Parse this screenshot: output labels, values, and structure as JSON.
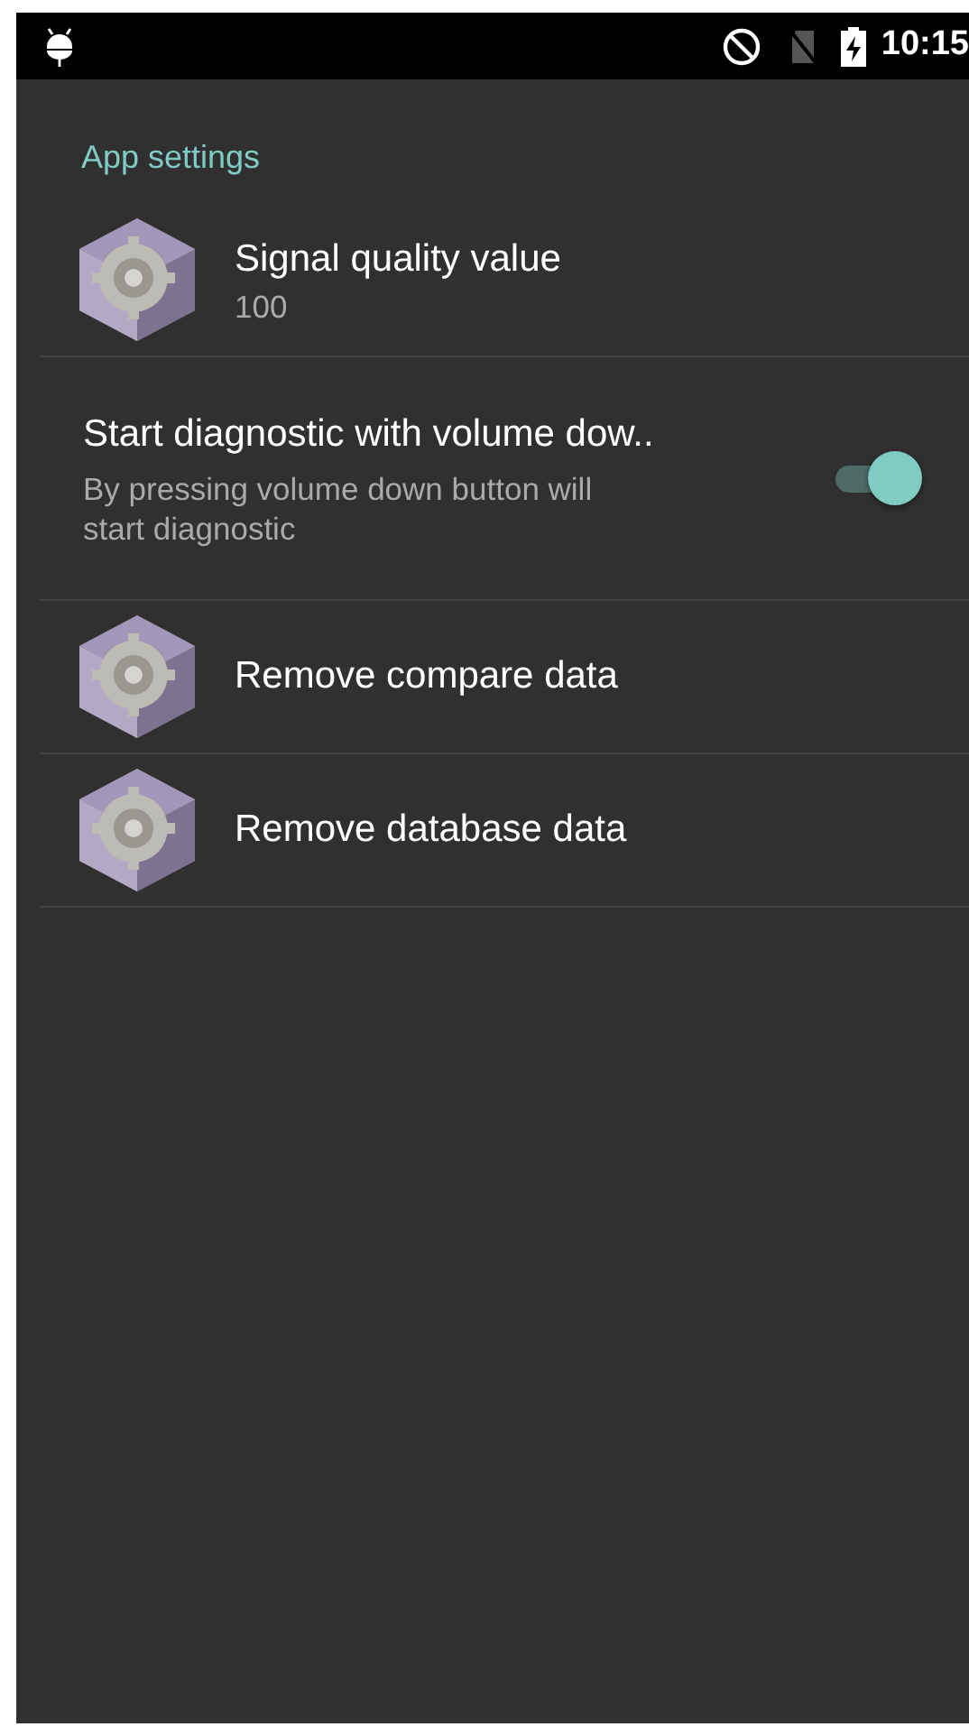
{
  "status_bar": {
    "time": "10:15"
  },
  "section": {
    "title": "App settings"
  },
  "items": [
    {
      "kind": "icon",
      "title": "Signal quality value",
      "summary": "100"
    },
    {
      "kind": "switch",
      "title": "Start diagnostic with volume dow..",
      "summary": "By pressing volume down button will start diagnostic",
      "checked": true
    },
    {
      "kind": "icon",
      "title": "Remove compare data"
    },
    {
      "kind": "icon",
      "title": "Remove database data"
    }
  ]
}
